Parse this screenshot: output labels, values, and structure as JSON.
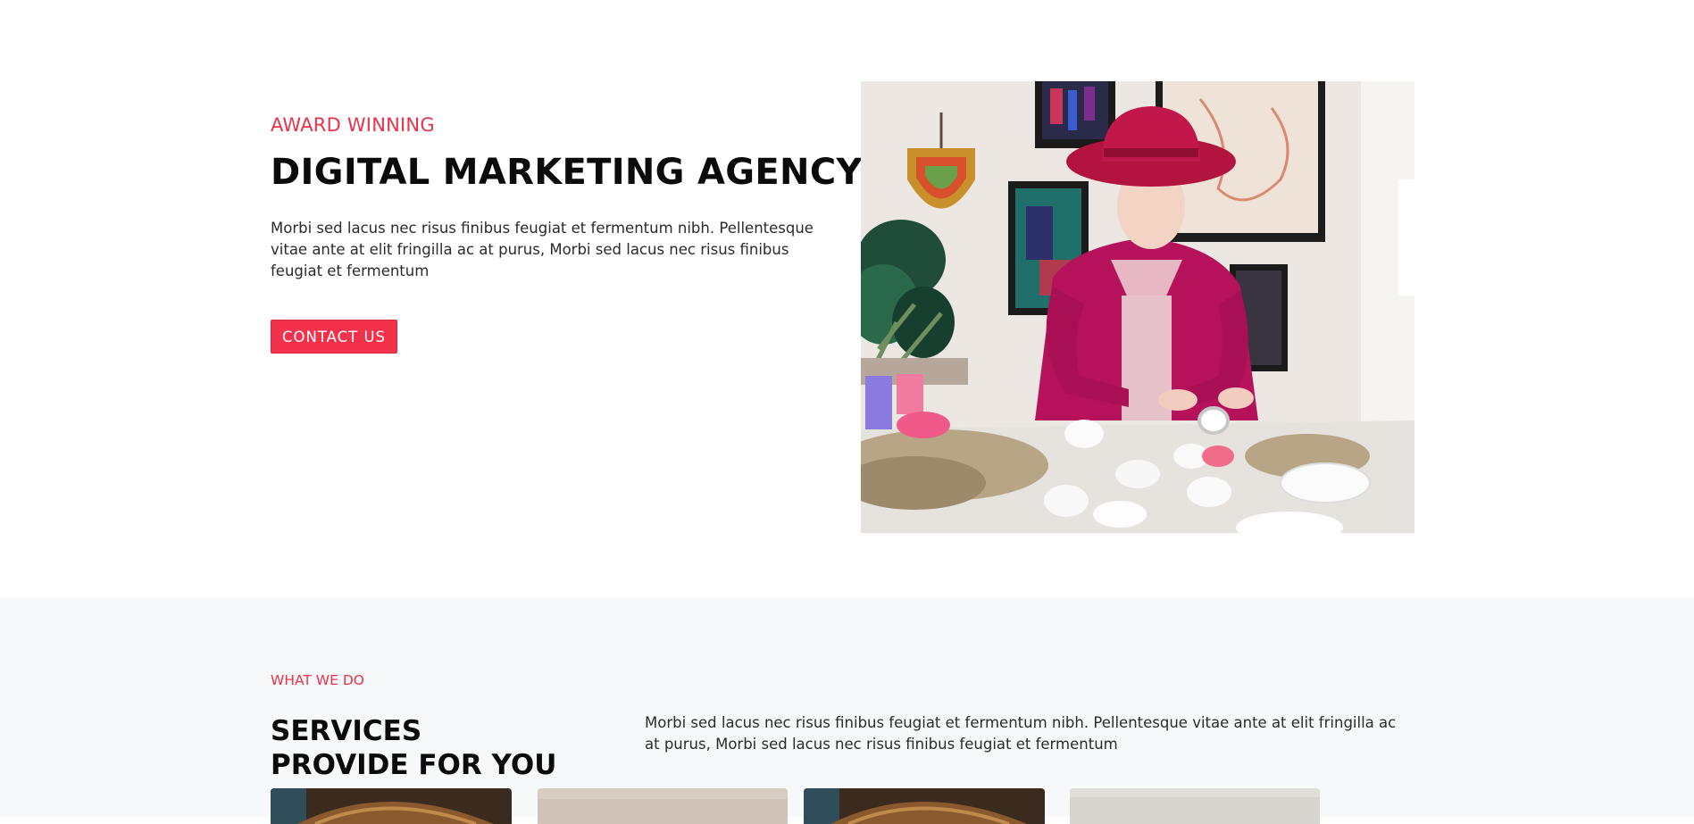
{
  "hero": {
    "eyebrow": "AWARD WINNING",
    "title": "DIGITAL MARKETING AGENCY",
    "description": "Morbi sed lacus nec risus finibus feugiat et fermentum nibh. Pellentesque vitae ante at elit fringilla ac at purus, Morbi sed lacus nec risus finibus feugiat et fermentum",
    "cta_label": "CONTACT US"
  },
  "services": {
    "eyebrow": "WHAT WE DO",
    "title": "SERVICES PROVIDE FOR YOU",
    "description": "Morbi sed lacus nec risus finibus feugiat et fermentum nibh. Pellentesque vitae ante at elit fringilla ac at purus, Morbi sed lacus nec risus finibus feugiat et fermentum"
  },
  "colors": {
    "accent": "#f2314a",
    "eyebrow": "#e8334a",
    "section_bg": "#f7f8f9"
  }
}
